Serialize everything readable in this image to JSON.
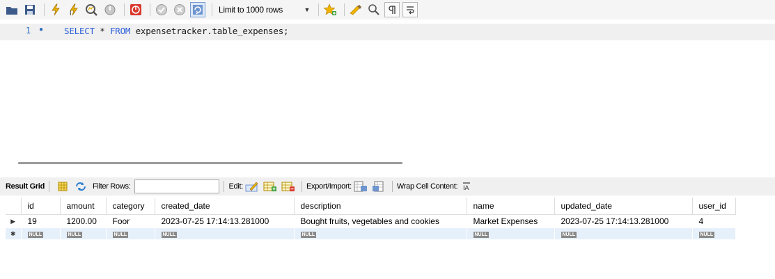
{
  "toolbar": {
    "limit_label": "Limit to 1000 rows",
    "icons": [
      "open-folder-icon",
      "save-icon",
      "execute-icon",
      "execute-current-icon",
      "explain-icon",
      "stop-icon",
      "toggle-stop-on-error-icon",
      "commit-icon",
      "rollback-icon",
      "autocommit-icon",
      "limit-dropdown",
      "add-snippet-icon",
      "beautify-icon",
      "find-icon",
      "invisible-chars-icon",
      "word-wrap-icon"
    ]
  },
  "editor": {
    "line_number": "1",
    "sql_keyword_1": "SELECT",
    "sql_star": " * ",
    "sql_keyword_2": "FROM",
    "sql_rest": " expensetracker.table_expenses;"
  },
  "result_toolbar": {
    "result_grid": "Result Grid",
    "filter_rows": "Filter Rows:",
    "edit": "Edit:",
    "export_import": "Export/Import:",
    "wrap_cell": "Wrap Cell Content:"
  },
  "grid": {
    "columns": [
      "id",
      "amount",
      "category",
      "created_date",
      "description",
      "name",
      "updated_date",
      "user_id"
    ],
    "rows": [
      [
        "19",
        "1200.00",
        "Foor",
        "2023-07-25 17:14:13.281000",
        "Bought fruits, vegetables and cookies",
        "Market Expenses",
        "2023-07-25 17:14:13.281000",
        "4"
      ]
    ],
    "null_label": "NULL"
  },
  "colors": {
    "keyword": "#2b5fd9",
    "line_number": "#2d6cc0",
    "new_row_bg": "#e6f0fb"
  }
}
